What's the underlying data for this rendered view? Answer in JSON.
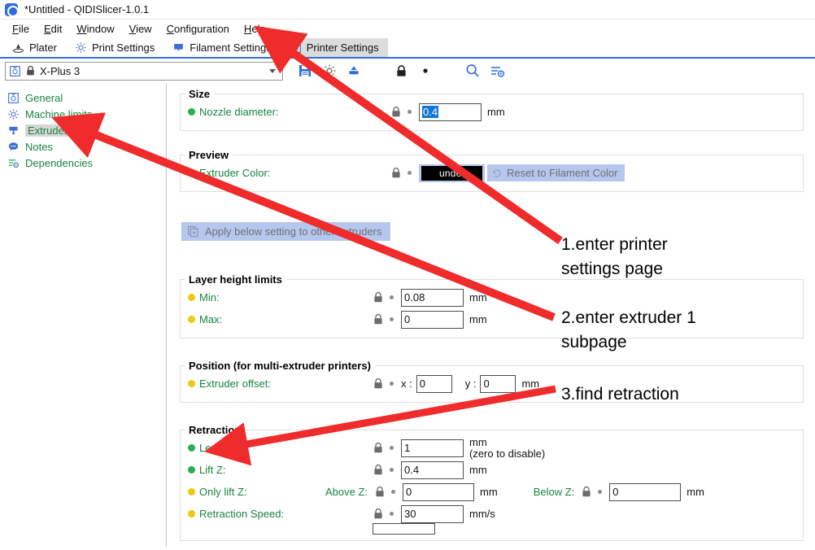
{
  "window": {
    "title": "*Untitled - QIDISlicer-1.0.1",
    "app_icon": "qidi-logo-icon"
  },
  "menubar": {
    "items": [
      {
        "label": "File",
        "mnemonic": "F"
      },
      {
        "label": "Edit",
        "mnemonic": "E"
      },
      {
        "label": "Window",
        "mnemonic": "W"
      },
      {
        "label": "View",
        "mnemonic": "V"
      },
      {
        "label": "Configuration",
        "mnemonic": "C"
      },
      {
        "label": "Help",
        "mnemonic": "H"
      }
    ]
  },
  "tabs": [
    {
      "label": "Plater",
      "icon": "plater-icon",
      "active": false
    },
    {
      "label": "Print Settings",
      "icon": "gear-icon",
      "active": false
    },
    {
      "label": "Filament Settings",
      "icon": "filament-spool-icon",
      "active": false
    },
    {
      "label": "Printer Settings",
      "icon": "printer-icon",
      "active": true
    }
  ],
  "preset": {
    "value": "X-Plus 3",
    "printer_icon": "printer-icon",
    "lock_icon": "lock-closed-icon",
    "dropdown_icon": "chevron-down-icon"
  },
  "toolbar": {
    "icons": [
      {
        "name": "save-icon",
        "color": "#2f6ddb"
      },
      {
        "name": "gear-icon",
        "color": "#6e6e6e"
      },
      {
        "name": "export-icon",
        "color": "#2f6ddb"
      },
      {
        "name": "lock-closed-icon",
        "color": "#222222"
      },
      {
        "name": "search-icon",
        "color": "#2f6ddb"
      },
      {
        "name": "compare-presets-icon",
        "color": "#2f6ddb"
      }
    ]
  },
  "sidebar": {
    "items": [
      {
        "label": "General",
        "icon": "printer-icon",
        "selected": false
      },
      {
        "label": "Machine limits",
        "icon": "gear-icon",
        "selected": false
      },
      {
        "label": "Extruder 1",
        "icon": "extruder-icon",
        "selected": true
      },
      {
        "label": "Notes",
        "icon": "notes-bubble-icon",
        "selected": false
      },
      {
        "label": "Dependencies",
        "icon": "dependencies-icon",
        "selected": false
      }
    ]
  },
  "groups": {
    "size": {
      "title": "Size",
      "nozzle_diameter": {
        "label": "Nozzle diameter:",
        "bullet": "green",
        "value": "0.4",
        "value_selected": true,
        "unit": "mm"
      }
    },
    "preview": {
      "title": "Preview",
      "extruder_color": {
        "label": "Extruder Color:",
        "bullet": "green",
        "swatch_text": "undef",
        "swatch_color": "#000000",
        "reset_label": "Reset to Filament Color"
      }
    },
    "apply_button": {
      "label": "Apply below setting to other extruders"
    },
    "layer_height_limits": {
      "title": "Layer height limits",
      "rows": [
        {
          "label": "Min:",
          "bullet": "yellow",
          "value": "0.08",
          "unit": "mm"
        },
        {
          "label": "Max:",
          "bullet": "yellow",
          "value": "0",
          "unit": "mm"
        }
      ]
    },
    "position": {
      "title": "Position (for multi-extruder printers)",
      "extruder_offset": {
        "label": "Extruder offset:",
        "bullet": "yellow",
        "x_label": "x :",
        "x_value": "0",
        "y_label": "y :",
        "y_value": "0",
        "unit": "mm"
      }
    },
    "retraction": {
      "title": "Retraction",
      "length": {
        "label": "Length:",
        "bullet": "green",
        "value": "1",
        "unit": "mm",
        "unit_sub": "(zero to disable)"
      },
      "lift_z": {
        "label": "Lift Z:",
        "bullet": "green",
        "value": "0.4",
        "unit": "mm"
      },
      "only_lift_z": {
        "label": "Only lift Z:",
        "bullet": "yellow",
        "above_label": "Above Z:",
        "above_value": "0",
        "above_unit": "mm",
        "below_label": "Below Z:",
        "below_value": "0",
        "below_unit": "mm"
      },
      "retraction_speed": {
        "label": "Retraction Speed:",
        "bullet": "yellow",
        "value": "30",
        "unit": "mm/s"
      }
    }
  },
  "annotations": {
    "arrow_color": "#ef2b2b",
    "notes": [
      {
        "text": "1.enter printer\nsettings page"
      },
      {
        "text": "2.enter extruder 1\nsubpage"
      },
      {
        "text": "3.find retraction"
      }
    ]
  }
}
